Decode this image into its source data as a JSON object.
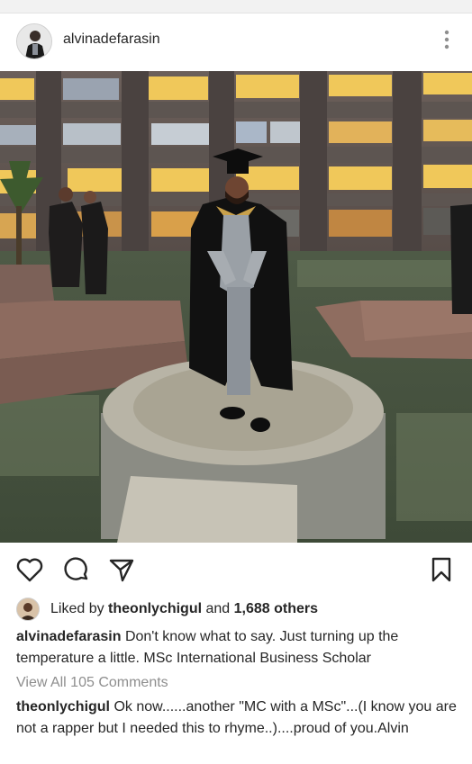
{
  "post": {
    "username": "alvinadefarasin",
    "liked_by_prefix": "Liked by",
    "liked_by_user": "theonlychigul",
    "liked_by_and": "and",
    "liked_by_count": "1,688 others",
    "caption_user": "alvinadefarasin",
    "caption_text": "Don't know what to say. Just turning up the temperature a little. MSc International Business Scholar",
    "view_comments": "View All 105 Comments",
    "comment_user": "theonlychigul",
    "comment_text": "Ok now......another \"MC with a MSc\"...(I know you are not a rapper but I needed this to rhyme..)....proud of you.Alvin"
  },
  "icons": {
    "more": "more-vertical-icon",
    "like": "heart-icon",
    "comment": "comment-bubble-icon",
    "share": "paper-plane-icon",
    "save": "bookmark-icon"
  },
  "colors": {
    "text": "#262626",
    "muted": "#8e8e8e",
    "divider": "#e3e3e3"
  }
}
